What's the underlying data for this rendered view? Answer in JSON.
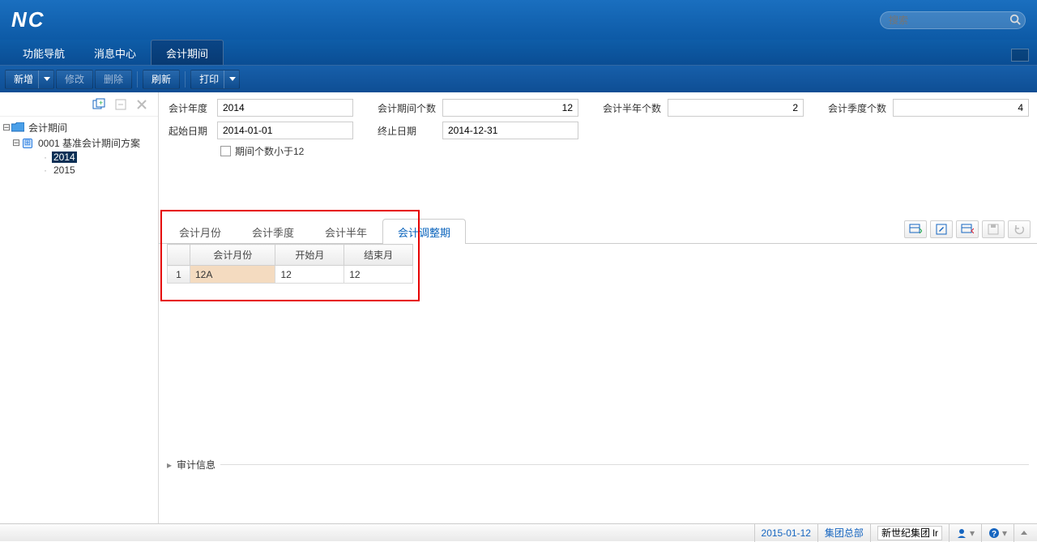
{
  "app": {
    "logo": "NC"
  },
  "search": {
    "placeholder": "搜索"
  },
  "nav": {
    "tabs": [
      {
        "label": "功能导航"
      },
      {
        "label": "消息中心"
      },
      {
        "label": "会计期间",
        "active": true
      }
    ]
  },
  "toolbar": {
    "new": "新增",
    "edit": "修改",
    "delete": "删除",
    "refresh": "刷新",
    "print": "打印"
  },
  "tree": {
    "root": "会计期间",
    "scheme": "0001 基准会计期间方案",
    "years": [
      "2014",
      "2015"
    ],
    "selected": "2014"
  },
  "form": {
    "labels": {
      "year": "会计年度",
      "periods": "会计期间个数",
      "halfyears": "会计半年个数",
      "quarters": "会计季度个数",
      "start": "起始日期",
      "end": "终止日期",
      "lt12": "期间个数小于12"
    },
    "values": {
      "year": "2014",
      "periods": "12",
      "halfyears": "2",
      "quarters": "4",
      "start": "2014-01-01",
      "end": "2014-12-31",
      "lt12": false
    }
  },
  "subtabs": [
    {
      "label": "会计月份"
    },
    {
      "label": "会计季度"
    },
    {
      "label": "会计半年"
    },
    {
      "label": "会计调整期",
      "active": true
    }
  ],
  "table": {
    "columns": [
      "会计月份",
      "开始月",
      "结束月"
    ],
    "rows": [
      {
        "n": "1",
        "month": "12A",
        "start": "12",
        "end": "12"
      }
    ]
  },
  "audit": {
    "label": "审计信息"
  },
  "status": {
    "date": "2015-01-12",
    "org": "集团总部",
    "group": "新世纪集团 lr"
  }
}
